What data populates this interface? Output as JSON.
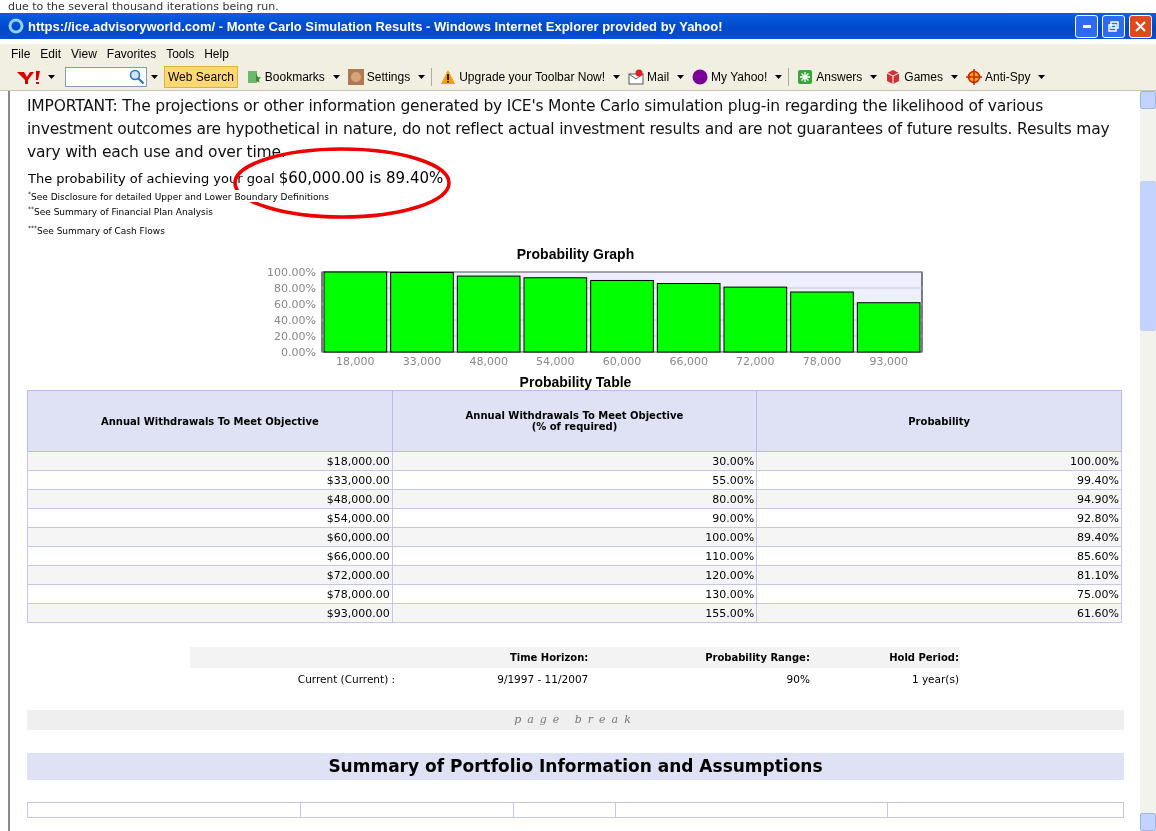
{
  "caption_top": "due to the several thousand iterations being run.",
  "window": {
    "title": "https://ice.advisoryworld.com/ - Monte Carlo Simulation Results - Windows Internet Explorer provided by Yahoo!"
  },
  "menu": [
    "File",
    "Edit",
    "View",
    "Favorites",
    "Tools",
    "Help"
  ],
  "toolbar": {
    "search_button": "Web Search",
    "items": [
      {
        "kind": "bookmarks",
        "label": "Bookmarks",
        "dropdown": true
      },
      {
        "kind": "face",
        "label": "Settings",
        "dropdown": true
      },
      {
        "kind": "warning",
        "label": "Upgrade your Toolbar Now!",
        "dropdown": true
      },
      {
        "kind": "mail",
        "label": "Mail",
        "dropdown": true
      },
      {
        "kind": "myyahoo",
        "label": "My Yahoo!",
        "dropdown": true
      },
      {
        "kind": "answers",
        "label": "Answers",
        "dropdown": true
      },
      {
        "kind": "games",
        "label": "Games",
        "dropdown": true
      },
      {
        "kind": "antispy",
        "label": "Anti-Spy",
        "dropdown": true
      }
    ]
  },
  "content": {
    "notice": "IMPORTANT: The projections or other information generated by ICE's Monte Carlo simulation plug-in regarding the likelihood of various investment outcomes are hypothetical in nature, do not reflect actual investment results and are not guarantees of future results. Results may vary with each use and over time.",
    "goal": "The probability of achieving your goal **$60,000.00 is 89.40%**",
    "footnotes": [
      "$^{*}$See Disclosure for detailed Upper and Lower Boundary Definitions",
      "$^{**}$See Summary of Financial Plan Analysis",
      "$^{***}$See Summary of Cash Flows"
    ],
    "chart": {
      "title": "Probability Graph",
      "chart_data": {
        "type": "bar",
        "categories": [
          "18,000",
          "33,000",
          "48,000",
          "54,000",
          "60,000",
          "66,000",
          "72,000",
          "78,000",
          "93,000"
        ],
        "grid": true,
        "series": [
          {
            "color": "#00ff00",
            "values": [
              100,
              99.4,
              94.9,
              92.8,
              89.4,
              85.6,
              81.1,
              75,
              61.6
            ]
          }
        ],
        "ylim": [
          0,
          100
        ],
        "yticks": [
          {
            "value": 0,
            "label": "0.00%"
          },
          {
            "value": 20,
            "label": "20.00%"
          },
          {
            "value": 40,
            "label": "40.00%"
          },
          {
            "value": 60,
            "label": "60.00%"
          },
          {
            "value": 80,
            "label": "80.00%"
          },
          {
            "value": 100,
            "label": "100.00%"
          }
        ]
      }
    },
    "table": {
      "title": "Probability Table",
      "columns": [
        {
          "label": "Annual Withdrawals To Meet Objective"
        },
        {
          "label": "Annual Withdrawals To Meet Objective",
          "note": "(% of required)"
        },
        {
          "label": "Probability"
        }
      ],
      "rows": [
        [
          "$18,000.00",
          "30.00%",
          "100.00%"
        ],
        [
          "$33,000.00",
          "55.00%",
          "99.40%"
        ],
        [
          "$48,000.00",
          "80.00%",
          "94.90%"
        ],
        [
          "$54,000.00",
          "90.00%",
          "92.80%"
        ],
        [
          "$60,000.00",
          "100.00%",
          "89.40%"
        ],
        [
          "$66,000.00",
          "110.00%",
          "85.60%"
        ],
        [
          "$72,000.00",
          "120.00%",
          "81.10%"
        ],
        [
          "$78,000.00",
          "130.00%",
          "75.00%"
        ],
        [
          "$93,000.00",
          "155.00%",
          "61.60%"
        ]
      ]
    },
    "horizon": {
      "columns": [
        "Time Horizon:",
        "Probability Range:",
        "Hold Period:"
      ],
      "row": {
        "label": "Current (Current) :",
        "values": [
          "9/1997 - 11/2007",
          "90%",
          "1 year(s)"
        ]
      }
    },
    "page_break": "page break",
    "section_title": "Summary of Portfolio Information and Assumptions"
  }
}
